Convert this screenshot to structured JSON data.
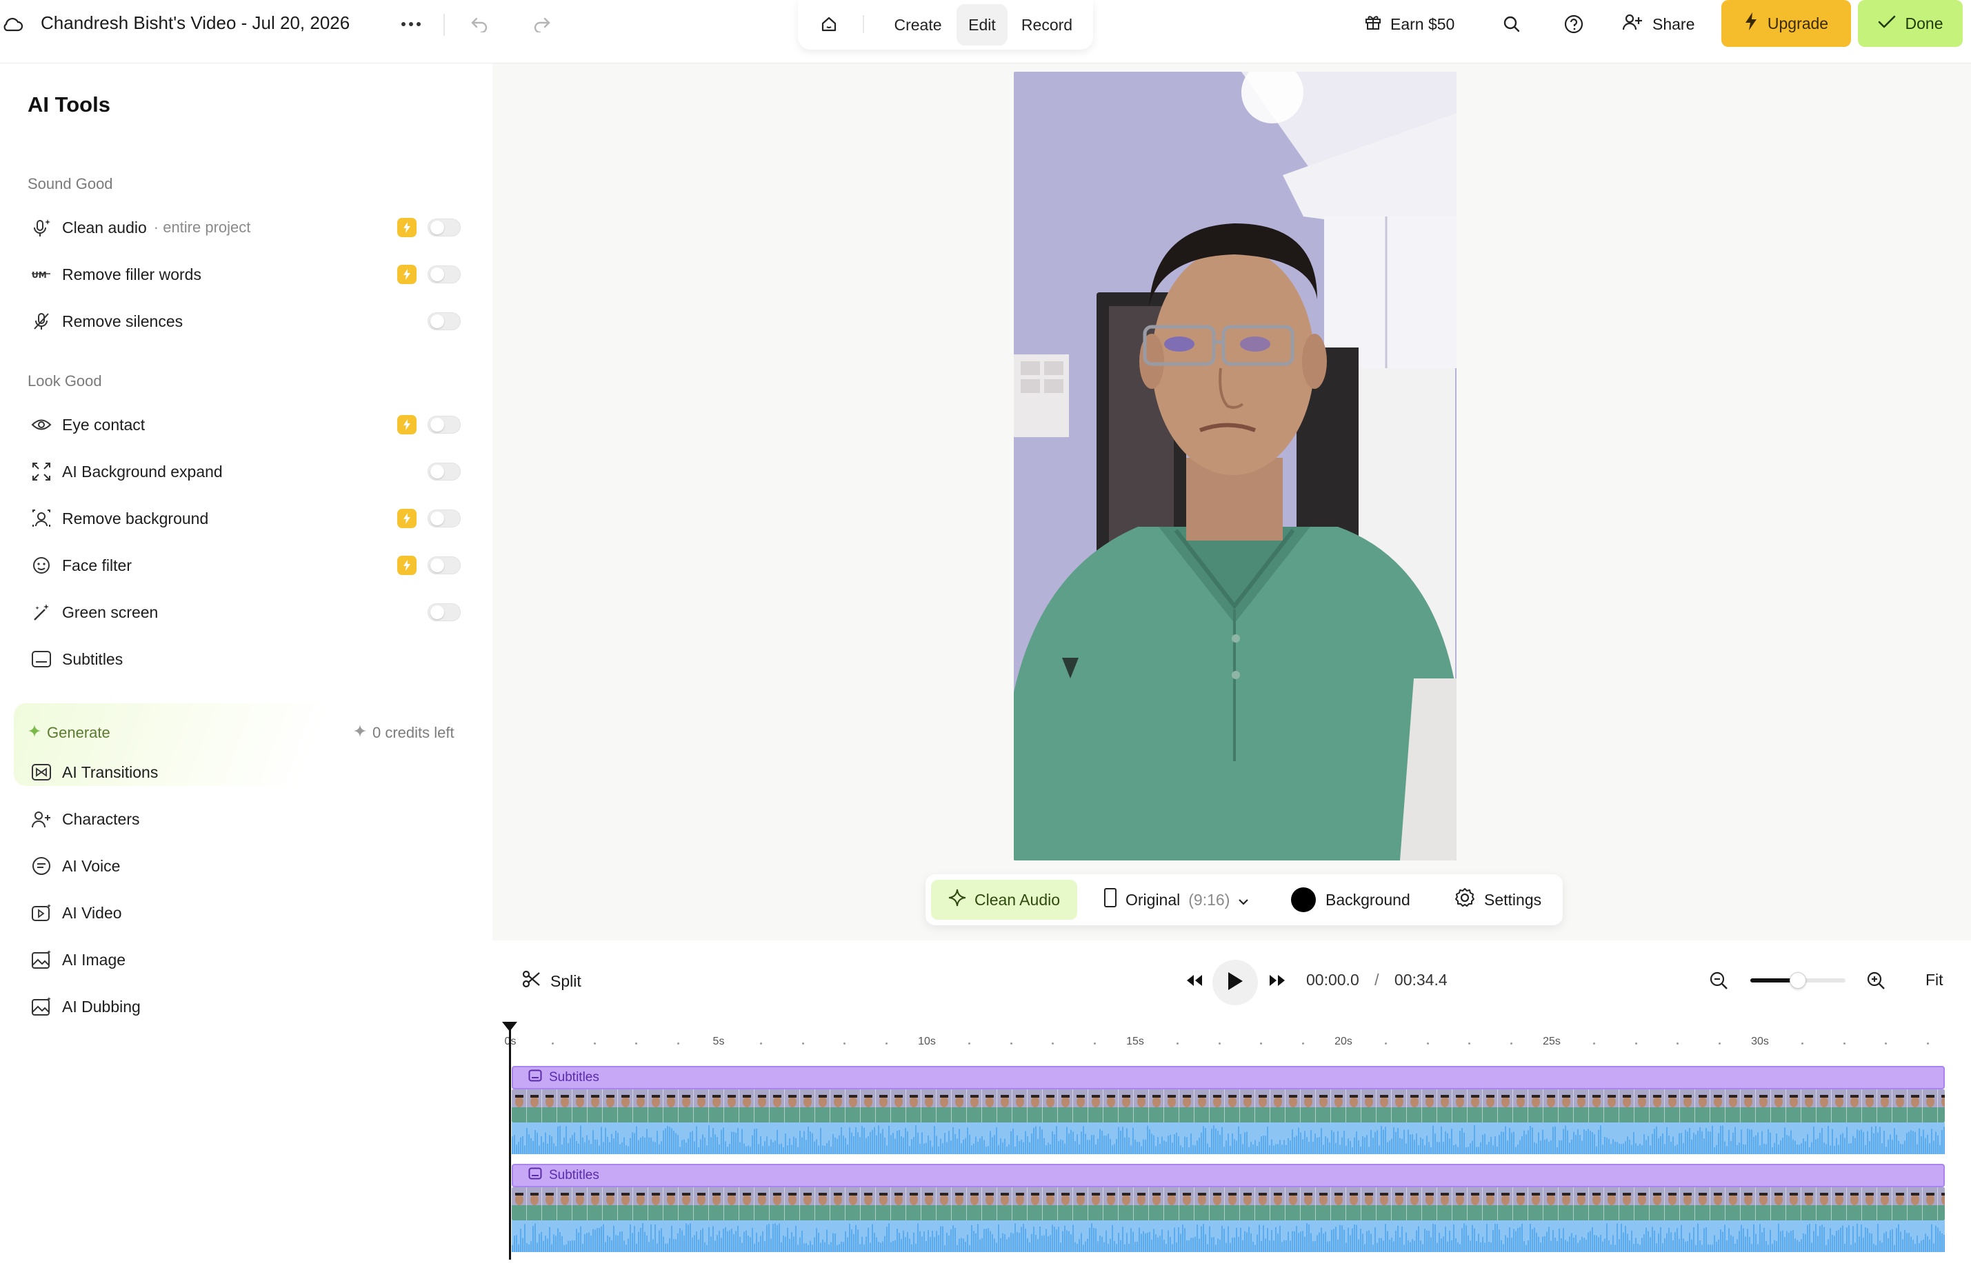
{
  "header": {
    "project_title": "Chandresh Bisht's Video - Jul 20, 2026",
    "modes": [
      "Create",
      "Edit",
      "Record"
    ],
    "active_mode": "Edit",
    "earn_label": "Earn $50",
    "share_label": "Share",
    "upgrade_label": "Upgrade",
    "done_label": "Done"
  },
  "sidebar": {
    "title": "AI Tools",
    "sections": [
      {
        "label": "Sound Good",
        "items": [
          {
            "label": "Clean audio",
            "sublabel": "· entire project",
            "icon": "mic-sparkle-icon",
            "premium": true,
            "toggle": false
          },
          {
            "label": "Remove filler words",
            "icon": "um-icon",
            "premium": true,
            "toggle": false
          },
          {
            "label": "Remove silences",
            "icon": "mic-off-icon",
            "premium": false,
            "toggle": false
          }
        ]
      },
      {
        "label": "Look Good",
        "items": [
          {
            "label": "Eye contact",
            "icon": "eye-icon",
            "premium": true,
            "toggle": false
          },
          {
            "label": "AI Background expand",
            "icon": "expand-icon",
            "premium": false,
            "toggle": false
          },
          {
            "label": "Remove background",
            "icon": "person-cutout-icon",
            "premium": true,
            "toggle": false
          },
          {
            "label": "Face filter",
            "icon": "face-filter-icon",
            "premium": true,
            "toggle": false
          },
          {
            "label": "Green screen",
            "icon": "magic-wand-icon",
            "premium": false,
            "toggle": false
          },
          {
            "label": "Subtitles",
            "icon": "subtitles-icon"
          }
        ]
      }
    ],
    "generate": {
      "label": "Generate",
      "credits": "0 credits left",
      "items": [
        {
          "label": "AI Transitions",
          "icon": "transitions-icon"
        },
        {
          "label": "Characters",
          "icon": "character-add-icon"
        },
        {
          "label": "AI Voice",
          "icon": "voice-icon"
        },
        {
          "label": "AI Video",
          "icon": "video-sparkle-icon"
        },
        {
          "label": "AI Image",
          "icon": "image-sparkle-icon"
        },
        {
          "label": "AI Dubbing",
          "icon": "dubbing-icon"
        }
      ]
    }
  },
  "canvas_toolbar": {
    "clean_audio": "Clean Audio",
    "ratio_label": "Original",
    "ratio_value": "(9:16)",
    "background_label": "Background",
    "background_color": "#000000",
    "settings_label": "Settings"
  },
  "playback": {
    "split_label": "Split",
    "current_time": "00:00.0",
    "separator": "/",
    "total_time": "00:34.4",
    "zoom_level": 0.5,
    "fit_label": "Fit"
  },
  "timeline": {
    "ruler_labels": [
      "0s",
      "5s",
      "10s",
      "15s",
      "20s",
      "25s",
      "30s"
    ],
    "tracks": [
      {
        "subtitle_label": "Subtitles"
      },
      {
        "subtitle_label": "Subtitles"
      }
    ]
  },
  "colors": {
    "upgrade": "#f5bd2c",
    "done": "#c5f27a",
    "clean_audio_bg": "#e7f8c9",
    "subtitle_track": "#c7a8f7",
    "waveform": "#5aaaf0",
    "premium_badge": "#f6c22e"
  }
}
